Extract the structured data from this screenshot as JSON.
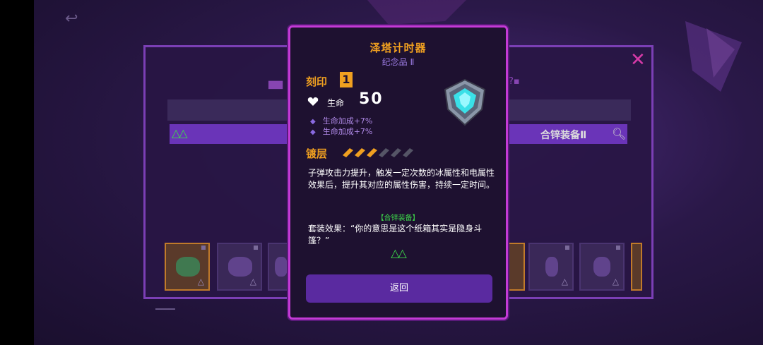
{
  "modal": {
    "title": "泽塔计时器",
    "subtitle": "纪念品 Ⅱ",
    "engrave_label": "刻印",
    "engrave_value": "1",
    "hp_label": "生命",
    "hp_value": "50",
    "bonuses": [
      "生命加成+7%",
      "生命加成+7%"
    ],
    "coating_label": "镀层",
    "coating_filled": 3,
    "coating_total": 6,
    "description": "子弹攻击力提升，触发一定次数的冰属性和电属性效果后，提升其对应的属性伤害，持续一定时间。",
    "set_name": "【合锌装备】",
    "set_effect": "套装效果：“你的意思是这个纸箱其实是隐身斗篷？”",
    "back_label": "返回"
  },
  "background": {
    "search_label": "合锌装备Ⅱ",
    "close_icon": "close-icon",
    "search_icon": "search-icon"
  },
  "colors": {
    "accent": "#f0a020",
    "border": "#c43ad6",
    "button": "#5a2aa0",
    "green": "#3ddc4a",
    "bonus": "#b08ae8"
  }
}
